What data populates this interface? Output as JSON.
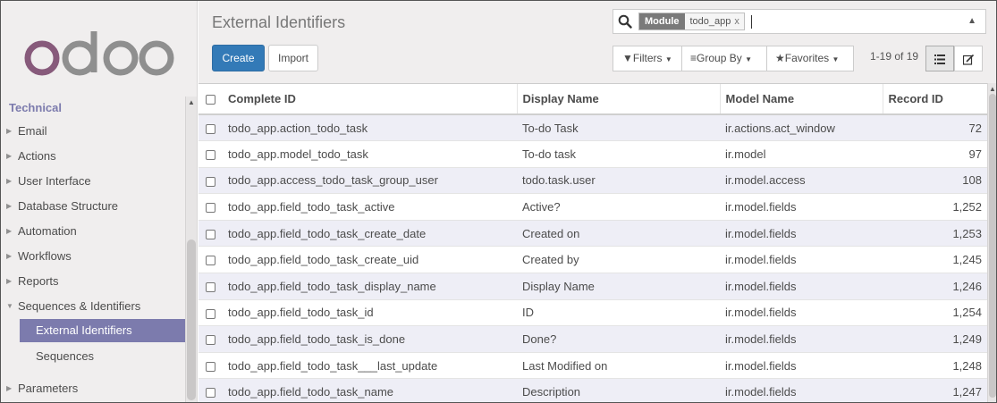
{
  "sidebar": {
    "heading": "Technical",
    "items": [
      {
        "label": "Email"
      },
      {
        "label": "Actions"
      },
      {
        "label": "User Interface"
      },
      {
        "label": "Database Structure"
      },
      {
        "label": "Automation"
      },
      {
        "label": "Workflows"
      },
      {
        "label": "Reports"
      },
      {
        "label": "Sequences & Identifiers"
      },
      {
        "label": "External Identifiers"
      },
      {
        "label": "Sequences"
      },
      {
        "label": "Parameters"
      }
    ]
  },
  "header": {
    "title": "External Identifiers",
    "create_label": "Create",
    "import_label": "Import"
  },
  "search": {
    "facet_label": "Module",
    "facet_value": "todo_app",
    "facet_remove": "x"
  },
  "filters": {
    "filters_label": "Filters",
    "groupby_label": "Group By",
    "favorites_label": "Favorites"
  },
  "pager": {
    "text": "1-19 of 19"
  },
  "table": {
    "headers": [
      "Complete ID",
      "Display Name",
      "Model Name",
      "Record ID"
    ],
    "rows": [
      [
        "todo_app.action_todo_task",
        "To-do Task",
        "ir.actions.act_window",
        "72"
      ],
      [
        "todo_app.model_todo_task",
        "To-do task",
        "ir.model",
        "97"
      ],
      [
        "todo_app.access_todo_task_group_user",
        "todo.task.user",
        "ir.model.access",
        "108"
      ],
      [
        "todo_app.field_todo_task_active",
        "Active?",
        "ir.model.fields",
        "1,252"
      ],
      [
        "todo_app.field_todo_task_create_date",
        "Created on",
        "ir.model.fields",
        "1,253"
      ],
      [
        "todo_app.field_todo_task_create_uid",
        "Created by",
        "ir.model.fields",
        "1,245"
      ],
      [
        "todo_app.field_todo_task_display_name",
        "Display Name",
        "ir.model.fields",
        "1,246"
      ],
      [
        "todo_app.field_todo_task_id",
        "ID",
        "ir.model.fields",
        "1,254"
      ],
      [
        "todo_app.field_todo_task_is_done",
        "Done?",
        "ir.model.fields",
        "1,249"
      ],
      [
        "todo_app.field_todo_task___last_update",
        "Last Modified on",
        "ir.model.fields",
        "1,248"
      ],
      [
        "todo_app.field_todo_task_name",
        "Description",
        "ir.model.fields",
        "1,247"
      ]
    ]
  },
  "colors": {
    "brand_purple": "#875a7b",
    "logo_gray": "#8f8f8f",
    "accent": "#7c7bad",
    "primary_button": "#337ab7"
  },
  "icons": [
    "odoo-logo",
    "search-icon",
    "filter-icon",
    "list-icon",
    "star-icon",
    "list-view-icon",
    "form-view-icon"
  ]
}
